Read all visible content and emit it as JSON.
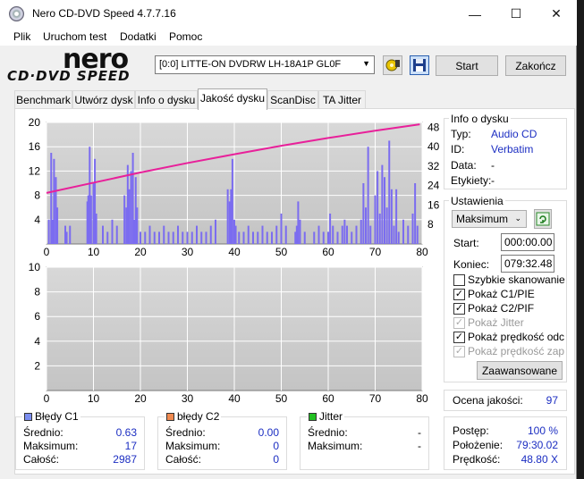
{
  "window": {
    "title": "Nero CD-DVD Speed 4.7.7.16",
    "minimize": "—",
    "maximize": "☐",
    "close": "✕"
  },
  "menu": [
    "Plik",
    "Uruchom test",
    "Dodatki",
    "Pomoc"
  ],
  "logo": {
    "brand": "nero",
    "product": "CD·DVD SPEED"
  },
  "toolbar": {
    "drive": "[0:0]   LITTE-ON DVDRW LH-18A1P GL0F",
    "start": "Start",
    "exit": "Zakończ"
  },
  "tabs": [
    "Benchmark",
    "Utwórz dysk",
    "Info o dysku",
    "Jakość dysku",
    "ScanDisc",
    "TA Jitter"
  ],
  "active_tab": "Jakość dysku",
  "chart_data": [
    {
      "type": "bar",
      "description_series": "C1 errors with read speed",
      "x_ticks": [
        0,
        10,
        20,
        30,
        40,
        50,
        60,
        70,
        80
      ],
      "y_left_ticks": [
        4,
        8,
        12,
        16,
        20
      ],
      "y_right_ticks": [
        8,
        16,
        24,
        32,
        40,
        48
      ],
      "xlim": [
        0,
        80
      ],
      "ylim_left": [
        0,
        20
      ],
      "ylim_right": [
        0,
        50
      ],
      "grid": true,
      "series": [
        {
          "name": "Błędy C1",
          "color": "#7b6cf0",
          "bars": [
            [
              0.5,
              4
            ],
            [
              1,
              15
            ],
            [
              1.3,
              4
            ],
            [
              1.6,
              14
            ],
            [
              2,
              11
            ],
            [
              2.3,
              6
            ],
            [
              4,
              3
            ],
            [
              4.3,
              2
            ],
            [
              5,
              3
            ],
            [
              8.7,
              7
            ],
            [
              8.9,
              8
            ],
            [
              9.2,
              16
            ],
            [
              9.5,
              8
            ],
            [
              10,
              10
            ],
            [
              10.3,
              14
            ],
            [
              10.6,
              5
            ],
            [
              12,
              3
            ],
            [
              13,
              2
            ],
            [
              14,
              4
            ],
            [
              15,
              3
            ],
            [
              16.6,
              8
            ],
            [
              17,
              6
            ],
            [
              17.3,
              13
            ],
            [
              17.6,
              9
            ],
            [
              18,
              12
            ],
            [
              18.4,
              15
            ],
            [
              18.7,
              4
            ],
            [
              19,
              11
            ],
            [
              19.3,
              6
            ],
            [
              20,
              2
            ],
            [
              21,
              2
            ],
            [
              22,
              3
            ],
            [
              23,
              2
            ],
            [
              24,
              2
            ],
            [
              25,
              3
            ],
            [
              26,
              2
            ],
            [
              27,
              2
            ],
            [
              28,
              3
            ],
            [
              29,
              2
            ],
            [
              30,
              2
            ],
            [
              31,
              2
            ],
            [
              32,
              3
            ],
            [
              33,
              2
            ],
            [
              34,
              2
            ],
            [
              35,
              3
            ],
            [
              36,
              4
            ],
            [
              38.6,
              9
            ],
            [
              39,
              7
            ],
            [
              39.3,
              9
            ],
            [
              39.6,
              14
            ],
            [
              40,
              4
            ],
            [
              40.3,
              3
            ],
            [
              41,
              2
            ],
            [
              42,
              2
            ],
            [
              43,
              3
            ],
            [
              44,
              2
            ],
            [
              45,
              2
            ],
            [
              46,
              3
            ],
            [
              47,
              2
            ],
            [
              48,
              2
            ],
            [
              49,
              3
            ],
            [
              50,
              5
            ],
            [
              51,
              3
            ],
            [
              53,
              2
            ],
            [
              53.3,
              3
            ],
            [
              53.6,
              7
            ],
            [
              54,
              4
            ],
            [
              55,
              2
            ],
            [
              57,
              2
            ],
            [
              58,
              3
            ],
            [
              59,
              2
            ],
            [
              60,
              2
            ],
            [
              60.4,
              5
            ],
            [
              61,
              3
            ],
            [
              62,
              2
            ],
            [
              63,
              3
            ],
            [
              63.5,
              4
            ],
            [
              64,
              3
            ],
            [
              65,
              2
            ],
            [
              66,
              3
            ],
            [
              67,
              4
            ],
            [
              67.5,
              10
            ],
            [
              68,
              6
            ],
            [
              68.5,
              16
            ],
            [
              69,
              3
            ],
            [
              70,
              8
            ],
            [
              70.5,
              12
            ],
            [
              71,
              5
            ],
            [
              71.5,
              13
            ],
            [
              72,
              11
            ],
            [
              72.5,
              6
            ],
            [
              73,
              17
            ],
            [
              73.5,
              9
            ],
            [
              74,
              3
            ],
            [
              74.5,
              9
            ],
            [
              75,
              2
            ],
            [
              76,
              4
            ],
            [
              77,
              3
            ],
            [
              78,
              5
            ],
            [
              78.5,
              10
            ],
            [
              79,
              3
            ]
          ]
        },
        {
          "name": "prędkość odczytu",
          "color": "#e8209a",
          "type": "line",
          "points": [
            [
              0,
              21
            ],
            [
              10,
              25.2
            ],
            [
              20,
              29.4
            ],
            [
              30,
              33.3
            ],
            [
              40,
              36.9
            ],
            [
              50,
              40.4
            ],
            [
              60,
              43.6
            ],
            [
              70,
              46.6
            ],
            [
              79.5,
              49.2
            ]
          ]
        }
      ]
    },
    {
      "type": "bar",
      "description_series": "C2 errors",
      "x_ticks": [
        0,
        10,
        20,
        30,
        40,
        50,
        60,
        70,
        80
      ],
      "y_left_ticks": [
        2,
        4,
        6,
        8,
        10
      ],
      "xlim": [
        0,
        80
      ],
      "ylim_left": [
        0,
        10
      ],
      "grid": true,
      "series": [
        {
          "name": "błędy C2",
          "color": "#e8793a",
          "bars": []
        }
      ]
    }
  ],
  "stats": {
    "c1": {
      "title": "Błędy C1",
      "color": "#7b8ef0",
      "avg_label": "Średnio:",
      "avg": "0.63",
      "max_label": "Maksimum:",
      "max": "17",
      "total_label": "Całość:",
      "total": "2987"
    },
    "c2": {
      "title": "błędy C2",
      "color": "#f08a50",
      "avg_label": "Średnio:",
      "avg": "0.00",
      "max_label": "Maksimum:",
      "max": "0",
      "total_label": "Całość:",
      "total": "0"
    },
    "jitter": {
      "title": "Jitter",
      "color": "#22c022",
      "avg_label": "Średnio:",
      "avg": "-",
      "max_label": "Maksimum:",
      "max": "-"
    }
  },
  "disc_info": {
    "title": "Info o dysku",
    "type_label": "Typ:",
    "type": "Audio CD",
    "id_label": "ID:",
    "id": "Verbatim",
    "date_label": "Data:",
    "date": "-",
    "tags_label": "Etykiety:",
    "tags": "-"
  },
  "settings": {
    "title": "Ustawienia",
    "speed": "Maksimum",
    "start_label": "Start:",
    "start": "000:00.00",
    "end_label": "Koniec:",
    "end": "079:32.48",
    "quick_scan": "Szybkie skanowanie",
    "show_c1": "Pokaż C1/PIE",
    "show_c2": "Pokaż C2/PIF",
    "show_jitter": "Pokaż Jitter",
    "show_read": "Pokaż prędkość odczyt",
    "show_write": "Pokaż prędkość zapisu",
    "advanced": "Zaawansowane"
  },
  "quality": {
    "label": "Ocena jakości:",
    "value": "97"
  },
  "progress": {
    "progress_label": "Postęp:",
    "progress": "100 %",
    "position_label": "Położenie:",
    "position": "79:30.02",
    "speed_label": "Prędkość:",
    "speed": "48.80 X"
  }
}
